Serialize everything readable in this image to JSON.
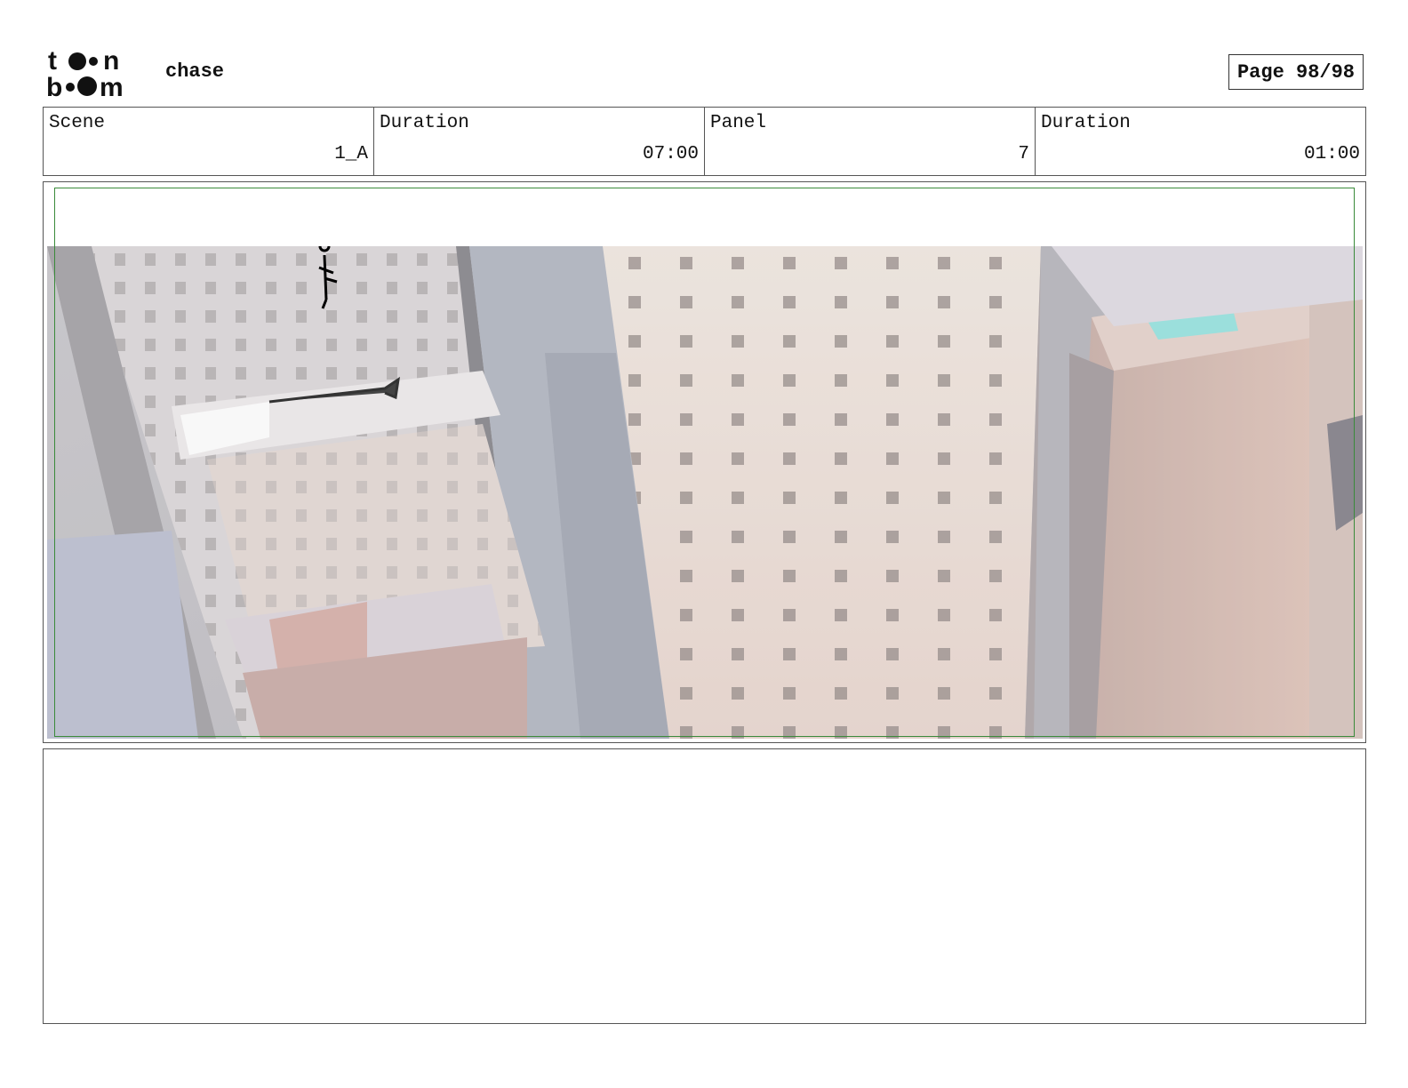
{
  "header": {
    "logo_text": "toon boom",
    "project_title": "chase",
    "page_label": "Page 98/98"
  },
  "info": {
    "scene_label": "Scene",
    "scene_value": "1_A",
    "scene_duration_label": "Duration",
    "scene_duration_value": "07:00",
    "panel_label": "Panel",
    "panel_value": "7",
    "panel_duration_label": "Duration",
    "panel_duration_value": "01:00"
  },
  "panel": {
    "description": ""
  },
  "colors": {
    "safe_frame": "#3a8a3a"
  }
}
